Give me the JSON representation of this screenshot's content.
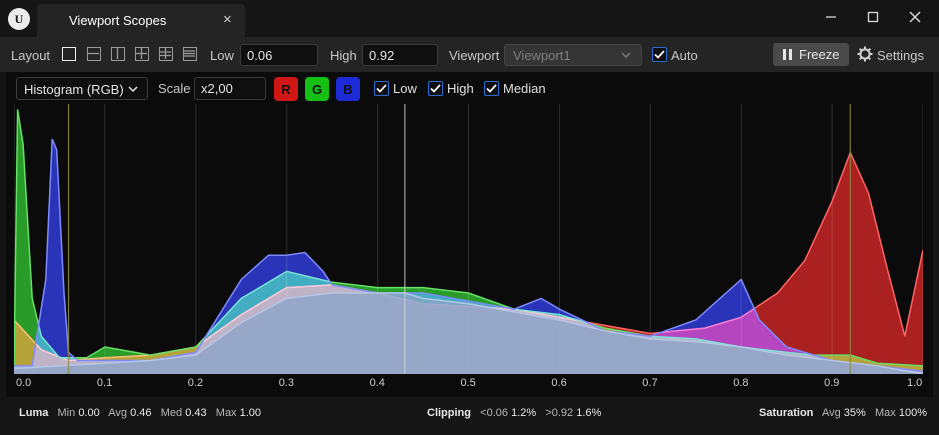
{
  "window": {
    "tab_title": "Viewport Scopes",
    "tab_close": "×",
    "minimize": "─",
    "maximize": "☐",
    "close": "✕"
  },
  "toolbar": {
    "layout_label": "Layout",
    "layout_icons": [
      "single-layout-icon",
      "two-rows-layout-icon",
      "two-columns-layout-icon",
      "quad-layout-icon",
      "grid-layout-icon",
      "list-layout-icon"
    ],
    "low_label": "Low",
    "low_value": "0.06",
    "high_label": "High",
    "high_value": "0.92",
    "viewport_label": "Viewport",
    "viewport_value": "Viewport1",
    "auto_label": "Auto",
    "auto_checked": true,
    "freeze_label": "Freeze",
    "settings_label": "Settings"
  },
  "controls": {
    "mode_value": "Histogram (RGB)",
    "scale_label": "Scale",
    "scale_value": "x2,00",
    "channels": [
      {
        "label": "R",
        "color": "#d11616"
      },
      {
        "label": "G",
        "color": "#14c014"
      },
      {
        "label": "B",
        "color": "#1c2ad8"
      }
    ],
    "low_label": "Low",
    "high_label": "High",
    "median_label": "Median",
    "low_checked": true,
    "high_checked": true,
    "median_checked": true
  },
  "chart_data": {
    "type": "area",
    "xlim": [
      0,
      1
    ],
    "ylim": [
      0,
      1
    ],
    "x_ticks": [
      "0.0",
      "0.1",
      "0.2",
      "0.3",
      "0.4",
      "0.5",
      "0.6",
      "0.7",
      "0.8",
      "0.9",
      "1.0"
    ],
    "markers": {
      "low": 0.06,
      "high": 0.92,
      "median": 0.43
    },
    "series": [
      {
        "name": "R",
        "color": "#c41a1a",
        "x": [
          0.0,
          0.03,
          0.06,
          0.1,
          0.15,
          0.2,
          0.25,
          0.3,
          0.35,
          0.4,
          0.45,
          0.5,
          0.55,
          0.6,
          0.65,
          0.7,
          0.73,
          0.76,
          0.8,
          0.84,
          0.87,
          0.9,
          0.92,
          0.94,
          0.96,
          0.98,
          1.0
        ],
        "y": [
          0.2,
          0.09,
          0.05,
          0.06,
          0.07,
          0.1,
          0.22,
          0.32,
          0.33,
          0.3,
          0.26,
          0.25,
          0.24,
          0.21,
          0.18,
          0.15,
          0.16,
          0.17,
          0.21,
          0.3,
          0.42,
          0.64,
          0.82,
          0.67,
          0.4,
          0.14,
          0.46
        ]
      },
      {
        "name": "G",
        "color": "#23b023",
        "x": [
          0.0,
          0.004,
          0.01,
          0.02,
          0.03,
          0.05,
          0.08,
          0.1,
          0.15,
          0.2,
          0.25,
          0.3,
          0.35,
          0.4,
          0.45,
          0.5,
          0.55,
          0.6,
          0.65,
          0.7,
          0.75,
          0.8,
          0.85,
          0.88,
          0.9,
          0.92,
          0.95,
          1.0
        ],
        "y": [
          0.02,
          0.98,
          0.85,
          0.28,
          0.14,
          0.06,
          0.06,
          0.1,
          0.07,
          0.1,
          0.28,
          0.38,
          0.34,
          0.32,
          0.32,
          0.3,
          0.24,
          0.22,
          0.17,
          0.14,
          0.13,
          0.1,
          0.08,
          0.07,
          0.07,
          0.07,
          0.04,
          0.03
        ]
      },
      {
        "name": "B",
        "color": "#2533d6",
        "x": [
          0.0,
          0.02,
          0.035,
          0.042,
          0.047,
          0.055,
          0.06,
          0.07,
          0.1,
          0.15,
          0.2,
          0.25,
          0.28,
          0.3,
          0.32,
          0.34,
          0.35,
          0.4,
          0.45,
          0.5,
          0.55,
          0.58,
          0.6,
          0.65,
          0.7,
          0.75,
          0.77,
          0.8,
          0.82,
          0.85,
          0.9,
          0.95,
          1.0
        ],
        "y": [
          0.03,
          0.03,
          0.35,
          0.87,
          0.83,
          0.3,
          0.08,
          0.05,
          0.05,
          0.05,
          0.08,
          0.35,
          0.44,
          0.44,
          0.45,
          0.38,
          0.33,
          0.3,
          0.3,
          0.27,
          0.24,
          0.28,
          0.24,
          0.16,
          0.14,
          0.2,
          0.26,
          0.35,
          0.2,
          0.1,
          0.05,
          0.03,
          0.01
        ]
      },
      {
        "name": "Luma",
        "color": "#8aa4c8",
        "x": [
          0.0,
          0.05,
          0.1,
          0.15,
          0.2,
          0.25,
          0.3,
          0.35,
          0.4,
          0.43,
          0.45,
          0.5,
          0.55,
          0.6,
          0.65,
          0.7,
          0.75,
          0.8,
          0.85,
          0.9,
          0.95,
          1.0
        ],
        "y": [
          0.02,
          0.03,
          0.04,
          0.05,
          0.07,
          0.19,
          0.28,
          0.3,
          0.3,
          0.3,
          0.28,
          0.26,
          0.23,
          0.2,
          0.16,
          0.13,
          0.12,
          0.1,
          0.07,
          0.05,
          0.03,
          0.0
        ]
      }
    ]
  },
  "stats": {
    "luma_label": "Luma",
    "luma_min_label": "Min",
    "luma_min": "0.00",
    "luma_avg_label": "Avg",
    "luma_avg": "0.46",
    "luma_med_label": "Med",
    "luma_med": "0.43",
    "luma_max_label": "Max",
    "luma_max": "1.00",
    "clipping_label": "Clipping",
    "clip_low_label": "<0.06",
    "clip_low": "1.2%",
    "clip_high_label": ">0.92",
    "clip_high": "1.6%",
    "saturation_label": "Saturation",
    "sat_avg_label": "Avg",
    "sat_avg": "35%",
    "sat_max_label": "Max",
    "sat_max": "100%"
  }
}
